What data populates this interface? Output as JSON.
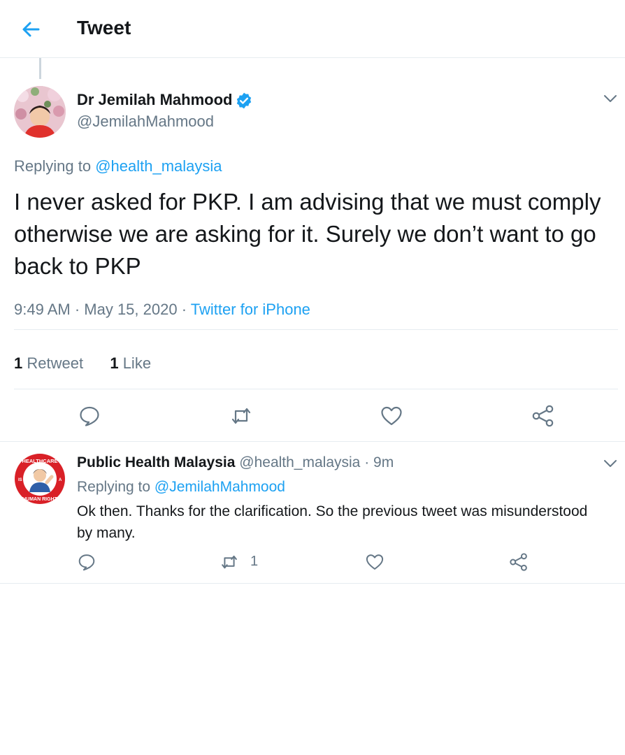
{
  "header": {
    "title": "Tweet",
    "back_icon": "arrow-left-icon"
  },
  "tweet": {
    "author_name": "Dr Jemilah Mahmood",
    "author_handle": "@JemilahMahmood",
    "replying_label": "Replying to",
    "replying_to": "@health_malaysia",
    "text": "I never asked for PKP. I am advising that we must comply otherwise we are asking for it. Surely we don’t want to go back to PKP",
    "time": "9:49 AM · May 15, 2020 · ",
    "source": "Twitter for iPhone",
    "retweet_count": "1",
    "retweet_label": " Retweet",
    "like_count": "1",
    "like_label": " Like"
  },
  "reply": {
    "author_name": "Public Health Malaysia",
    "author_handle": "@health_malaysia",
    "time": "9m",
    "replying_label": "Replying to",
    "replying_to": "@JemilahMahmood",
    "text": "Ok then. Thanks for the clarification. So the previous tweet was misunderstood by many.",
    "retweet_count": "1",
    "avatar_text_top": "HEALTHCARE",
    "avatar_text_bottom": "HUMAN RIGHT",
    "avatar_text_left": "IS",
    "avatar_text_right": "A"
  },
  "colors": {
    "accent": "#1da1f2",
    "text": "#14171a",
    "muted": "#657786",
    "border": "#e6ecf0",
    "badge_red": "#d92027"
  }
}
